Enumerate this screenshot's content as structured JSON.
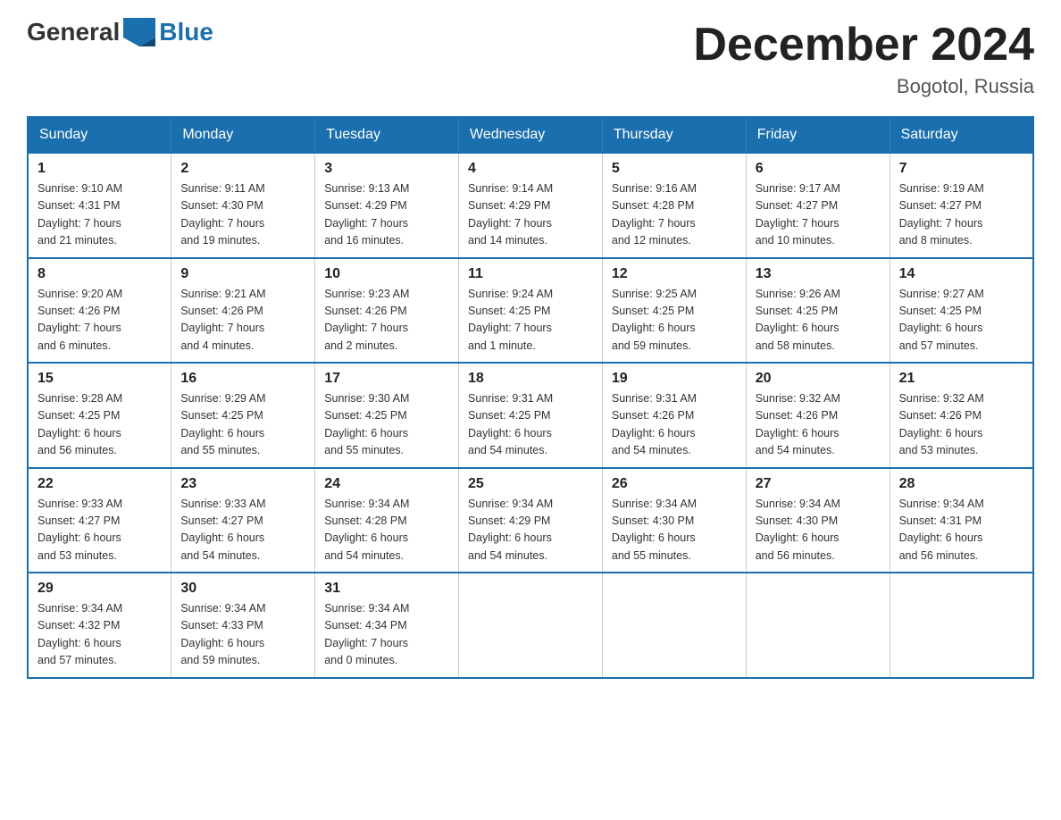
{
  "logo": {
    "general": "General",
    "blue": "Blue"
  },
  "header": {
    "month_year": "December 2024",
    "location": "Bogotol, Russia"
  },
  "days_of_week": [
    "Sunday",
    "Monday",
    "Tuesday",
    "Wednesday",
    "Thursday",
    "Friday",
    "Saturday"
  ],
  "weeks": [
    [
      {
        "day": "1",
        "sunrise": "9:10 AM",
        "sunset": "4:31 PM",
        "daylight": "7 hours and 21 minutes."
      },
      {
        "day": "2",
        "sunrise": "9:11 AM",
        "sunset": "4:30 PM",
        "daylight": "7 hours and 19 minutes."
      },
      {
        "day": "3",
        "sunrise": "9:13 AM",
        "sunset": "4:29 PM",
        "daylight": "7 hours and 16 minutes."
      },
      {
        "day": "4",
        "sunrise": "9:14 AM",
        "sunset": "4:29 PM",
        "daylight": "7 hours and 14 minutes."
      },
      {
        "day": "5",
        "sunrise": "9:16 AM",
        "sunset": "4:28 PM",
        "daylight": "7 hours and 12 minutes."
      },
      {
        "day": "6",
        "sunrise": "9:17 AM",
        "sunset": "4:27 PM",
        "daylight": "7 hours and 10 minutes."
      },
      {
        "day": "7",
        "sunrise": "9:19 AM",
        "sunset": "4:27 PM",
        "daylight": "7 hours and 8 minutes."
      }
    ],
    [
      {
        "day": "8",
        "sunrise": "9:20 AM",
        "sunset": "4:26 PM",
        "daylight": "7 hours and 6 minutes."
      },
      {
        "day": "9",
        "sunrise": "9:21 AM",
        "sunset": "4:26 PM",
        "daylight": "7 hours and 4 minutes."
      },
      {
        "day": "10",
        "sunrise": "9:23 AM",
        "sunset": "4:26 PM",
        "daylight": "7 hours and 2 minutes."
      },
      {
        "day": "11",
        "sunrise": "9:24 AM",
        "sunset": "4:25 PM",
        "daylight": "7 hours and 1 minute."
      },
      {
        "day": "12",
        "sunrise": "9:25 AM",
        "sunset": "4:25 PM",
        "daylight": "6 hours and 59 minutes."
      },
      {
        "day": "13",
        "sunrise": "9:26 AM",
        "sunset": "4:25 PM",
        "daylight": "6 hours and 58 minutes."
      },
      {
        "day": "14",
        "sunrise": "9:27 AM",
        "sunset": "4:25 PM",
        "daylight": "6 hours and 57 minutes."
      }
    ],
    [
      {
        "day": "15",
        "sunrise": "9:28 AM",
        "sunset": "4:25 PM",
        "daylight": "6 hours and 56 minutes."
      },
      {
        "day": "16",
        "sunrise": "9:29 AM",
        "sunset": "4:25 PM",
        "daylight": "6 hours and 55 minutes."
      },
      {
        "day": "17",
        "sunrise": "9:30 AM",
        "sunset": "4:25 PM",
        "daylight": "6 hours and 55 minutes."
      },
      {
        "day": "18",
        "sunrise": "9:31 AM",
        "sunset": "4:25 PM",
        "daylight": "6 hours and 54 minutes."
      },
      {
        "day": "19",
        "sunrise": "9:31 AM",
        "sunset": "4:26 PM",
        "daylight": "6 hours and 54 minutes."
      },
      {
        "day": "20",
        "sunrise": "9:32 AM",
        "sunset": "4:26 PM",
        "daylight": "6 hours and 54 minutes."
      },
      {
        "day": "21",
        "sunrise": "9:32 AM",
        "sunset": "4:26 PM",
        "daylight": "6 hours and 53 minutes."
      }
    ],
    [
      {
        "day": "22",
        "sunrise": "9:33 AM",
        "sunset": "4:27 PM",
        "daylight": "6 hours and 53 minutes."
      },
      {
        "day": "23",
        "sunrise": "9:33 AM",
        "sunset": "4:27 PM",
        "daylight": "6 hours and 54 minutes."
      },
      {
        "day": "24",
        "sunrise": "9:34 AM",
        "sunset": "4:28 PM",
        "daylight": "6 hours and 54 minutes."
      },
      {
        "day": "25",
        "sunrise": "9:34 AM",
        "sunset": "4:29 PM",
        "daylight": "6 hours and 54 minutes."
      },
      {
        "day": "26",
        "sunrise": "9:34 AM",
        "sunset": "4:30 PM",
        "daylight": "6 hours and 55 minutes."
      },
      {
        "day": "27",
        "sunrise": "9:34 AM",
        "sunset": "4:30 PM",
        "daylight": "6 hours and 56 minutes."
      },
      {
        "day": "28",
        "sunrise": "9:34 AM",
        "sunset": "4:31 PM",
        "daylight": "6 hours and 56 minutes."
      }
    ],
    [
      {
        "day": "29",
        "sunrise": "9:34 AM",
        "sunset": "4:32 PM",
        "daylight": "6 hours and 57 minutes."
      },
      {
        "day": "30",
        "sunrise": "9:34 AM",
        "sunset": "4:33 PM",
        "daylight": "6 hours and 59 minutes."
      },
      {
        "day": "31",
        "sunrise": "9:34 AM",
        "sunset": "4:34 PM",
        "daylight": "7 hours and 0 minutes."
      },
      null,
      null,
      null,
      null
    ]
  ],
  "labels": {
    "sunrise": "Sunrise:",
    "sunset": "Sunset:",
    "daylight": "Daylight:"
  }
}
